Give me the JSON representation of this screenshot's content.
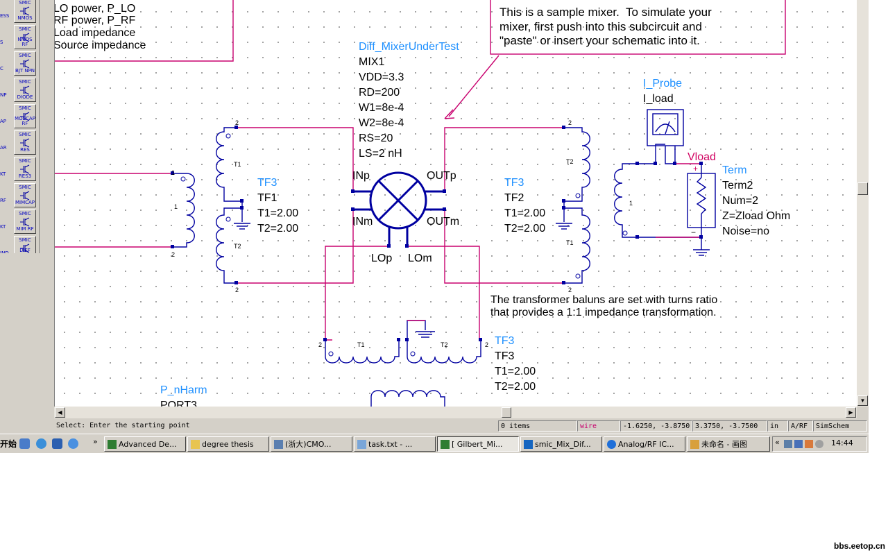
{
  "palette": {
    "items": [
      {
        "top": "SMIC",
        "bottom": "NMOS",
        "left": "ESS"
      },
      {
        "top": "SMIC",
        "bottom": "NMOS RF",
        "left": "S"
      },
      {
        "top": "SMIC",
        "bottom": "BJT NPN",
        "left": "C"
      },
      {
        "top": "SMIC",
        "bottom": "DIODE",
        "left": "NP"
      },
      {
        "top": "SMIC",
        "bottom": "MOSCAP RF",
        "left": "AP"
      },
      {
        "top": "SMIC",
        "bottom": "RES",
        "left": "AR"
      },
      {
        "top": "SMIC",
        "bottom": "RES3",
        "left": "KT"
      },
      {
        "top": "SMIC",
        "bottom": "MIMCAP",
        "left": "RF"
      },
      {
        "top": "SMIC",
        "bottom": "MIM RF",
        "left": "KT"
      },
      {
        "top": "SMIC",
        "bottom": "DIFF IND",
        "left": "IND"
      }
    ]
  },
  "schematic": {
    "param_box_lines": [
      "LO power, P_LO",
      "RF power, P_RF",
      "Load impedance",
      "Source impedance"
    ],
    "note_box": [
      "This is a sample mixer.  To simulate your",
      "mixer, first push into this subcircuit and",
      "\"paste\" or insert your schematic into it."
    ],
    "mixer": {
      "model": "Diff_MixerUnderTest",
      "params": [
        "MIX1",
        "VDD=3.3",
        "RD=200",
        "W1=8e-4",
        "W2=8e-4",
        "RS=20",
        "LS=2 nH"
      ],
      "pins": {
        "inp": "INp",
        "inm": "INm",
        "outp": "OUTp",
        "outm": "OUTm",
        "lop": "LOp",
        "lom": "LOm"
      }
    },
    "tf1": {
      "model": "TF3",
      "params": [
        "TF1",
        "T1=2.00",
        "T2=2.00"
      ]
    },
    "tf2": {
      "model": "TF3",
      "params": [
        "TF2",
        "T1=2.00",
        "T2=2.00"
      ]
    },
    "tf3": {
      "model": "TF3",
      "params": [
        "TF3",
        "T1=2.00",
        "T2=2.00"
      ]
    },
    "probe": {
      "model": "I_Probe",
      "name": "I_load"
    },
    "node_label": "Vload",
    "term": {
      "model": "Term",
      "params": [
        "Term2",
        "Num=2",
        "Z=Zload Ohm",
        "Noise=no"
      ]
    },
    "balun_note": [
      "The transformer baluns are set with turns ratio",
      "that provides a 1:1 impedance transformation."
    ],
    "port": {
      "model": "P_nHarm",
      "name": "PORT3"
    },
    "pin_small": {
      "one": "1",
      "two": "2",
      "t1": "T1",
      "t2": "T2"
    }
  },
  "status": {
    "prompt": "Select: Enter the starting point",
    "items": "0 items",
    "mode": "wire",
    "coords1": "-1.6250, -3.8750",
    "coords2": "3.3750, -3.7500",
    "units": "in",
    "lib": "A/RF",
    "tool": "SimSchem"
  },
  "taskbar": {
    "start": "开始",
    "tasks": [
      "Advanced De...",
      "degree thesis",
      "(浙大)CMO...",
      "task.txt - ...",
      "[ Gilbert_Mi...",
      "smic_Mix_Dif...",
      "Analog/RF IC...",
      "未命名 - 画图"
    ],
    "clock": "14:44"
  },
  "watermark": "bbs.eetop.cn",
  "colors": {
    "wire": "#c8006e",
    "component": "#0000a0",
    "label": "#1e90ff",
    "node": "#d00060"
  }
}
